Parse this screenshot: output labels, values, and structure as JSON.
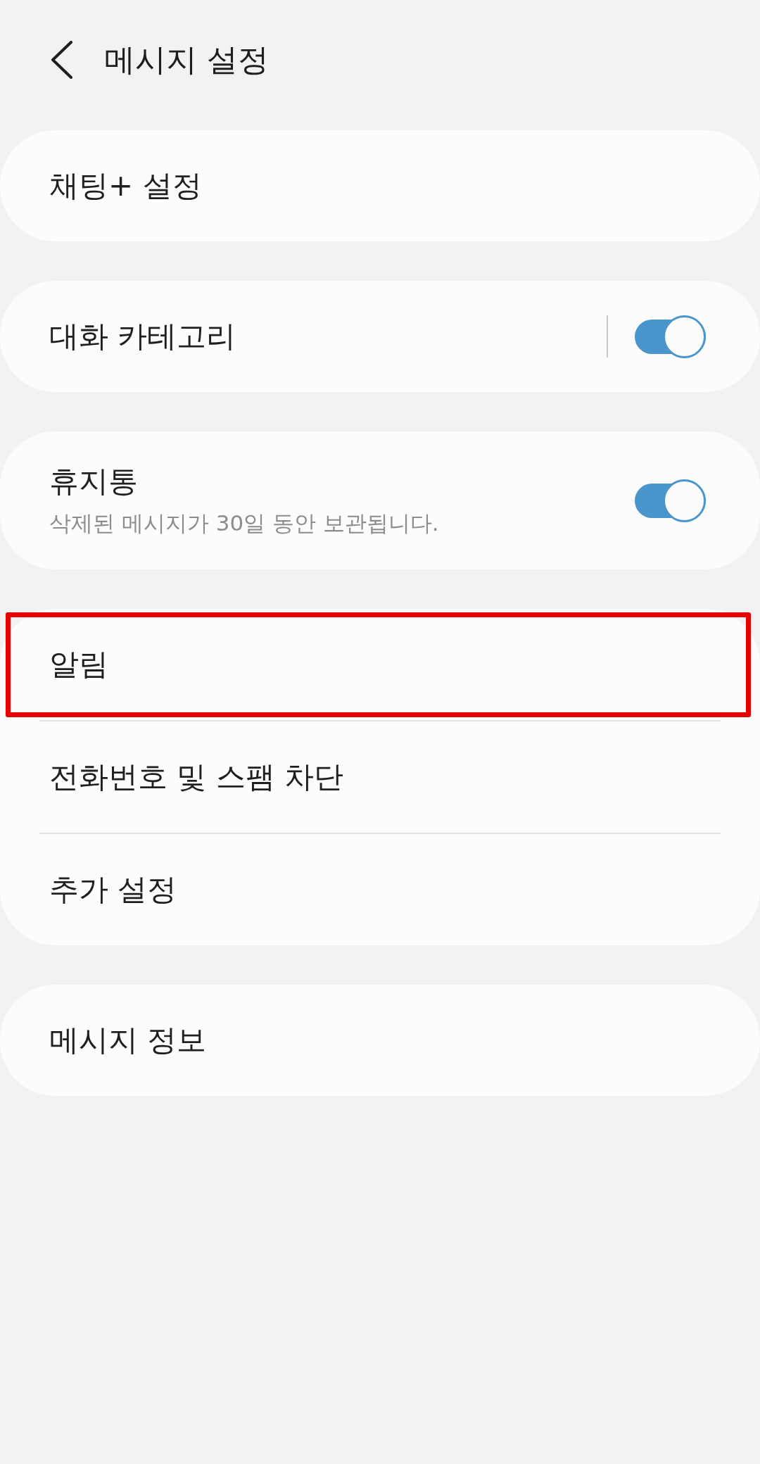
{
  "header": {
    "title": "메시지 설정"
  },
  "groups": [
    {
      "items": [
        {
          "kind": "link",
          "label": "채팅+ 설정",
          "highlighted": false
        }
      ]
    },
    {
      "items": [
        {
          "kind": "split-switch",
          "label": "대화 카테고리",
          "on": true,
          "highlighted": false
        }
      ]
    },
    {
      "items": [
        {
          "kind": "switch",
          "label": "휴지통",
          "description": "삭제된 메시지가 30일 동안 보관됩니다.",
          "on": true,
          "highlighted": false
        }
      ]
    },
    {
      "items": [
        {
          "kind": "link",
          "label": "알림",
          "highlighted": true
        },
        {
          "kind": "link",
          "label": "전화번호 및 스팸 차단",
          "highlighted": false
        },
        {
          "kind": "link",
          "label": "추가 설정",
          "highlighted": false
        }
      ]
    },
    {
      "items": [
        {
          "kind": "link",
          "label": "메시지 정보",
          "highlighted": false
        }
      ]
    }
  ]
}
